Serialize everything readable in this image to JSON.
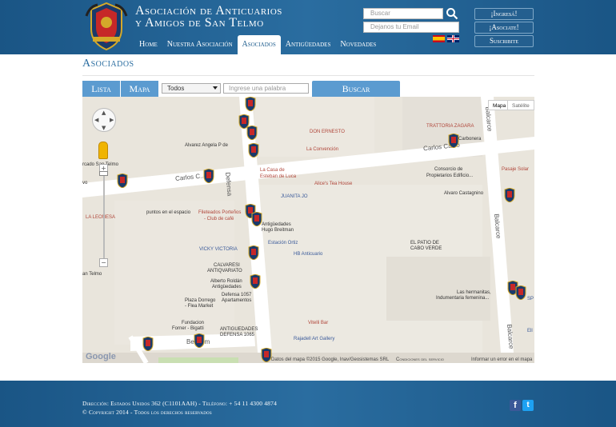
{
  "header": {
    "title_line1": "Asociación de Anticuarios",
    "title_line2": "y Amigos de San Telmo",
    "nav": [
      {
        "label": "Home"
      },
      {
        "label": "Nuestra Asociación"
      },
      {
        "label": "Asociados"
      },
      {
        "label": "Antigüedades"
      },
      {
        "label": "Novedades"
      }
    ],
    "search_placeholder": "Buscar",
    "email_placeholder": "Dejanos tu Email",
    "buttons": {
      "login": "¡Ingresá!",
      "join": "¡Asociate!",
      "subscribe": "Suscribite"
    }
  },
  "page": {
    "title": "Asociados",
    "tabs": {
      "list": "Lista",
      "map": "Mapa"
    },
    "filter": {
      "selected": "Todos",
      "keyword_placeholder": "Ingrese una palabra",
      "search_button": "Buscar"
    }
  },
  "map": {
    "type_buttons": {
      "map": "Mapa",
      "satellite": "Satélite"
    },
    "streets": {
      "carlos_calvo_left": "Carlos C...",
      "carlos_calvo_right": "Carlos Calvo",
      "defensa": "Defensa",
      "balcarce_top": "Balcarce",
      "balcarce_mid": "Balcarce",
      "balcarce_bottom": "Balcarce",
      "bethlem": "Bethlem",
      "mercado": "rcado San Telmo",
      "santelmo": "an Telmo",
      "vo": "vo"
    },
    "places": [
      "DON ERNESTO",
      "La Convención",
      "TRATTORIA ZAGARA",
      "Carbonera",
      "Alvarez Angela P de",
      "La Casa de",
      "Esteban de Luca",
      "Alice's Tea House",
      "Consorcio de",
      "Propietarios Edificio...",
      "Pasaje Solar",
      "JUANITA JO",
      "Alvaro Castagnino",
      "LA LEONESA",
      "puntos en el espacio",
      "Fileteados Porteños",
      "- Club de café",
      "Antigüedades",
      "Hugo Breitman",
      "Estación Ortiz",
      "HB Anticuario",
      "VICKY VICTORIA",
      "EL PATIO DE",
      "CABO VERDE",
      "CALVARESI",
      "ANTIQVARIATO",
      "Alberto Roldán",
      "Antigüedades",
      "Defensa 1057",
      "Plaza Dorrego",
      "Apartamentos",
      "- Flea Market",
      "Las hermanitas,",
      "Indumentaria femenina...",
      "Vitelli Bar",
      "Fundacion",
      "Forner - Bigatti",
      "ANTIGUEDADES",
      "DEFENSA 1065",
      "Rajadell Art Gallery",
      "SP",
      "Ell"
    ],
    "attribution": "Datos del mapa ©2015 Google, Inav/Geosistemas SRL",
    "terms": "Condiciones del servicio",
    "report": "Informar un error en el mapa",
    "google": "Google"
  },
  "footer": {
    "address": "Dirección: Estados Unidos 362 (C1101AAH) - Teléfono: + 54 11 4300 4874",
    "copyright": "© Copyright 2014 - Todos los derechos reservados"
  },
  "colors": {
    "brand": "#1e5d8e",
    "tab": "#5b9bd0",
    "map_bg": "#e8e4dc"
  }
}
